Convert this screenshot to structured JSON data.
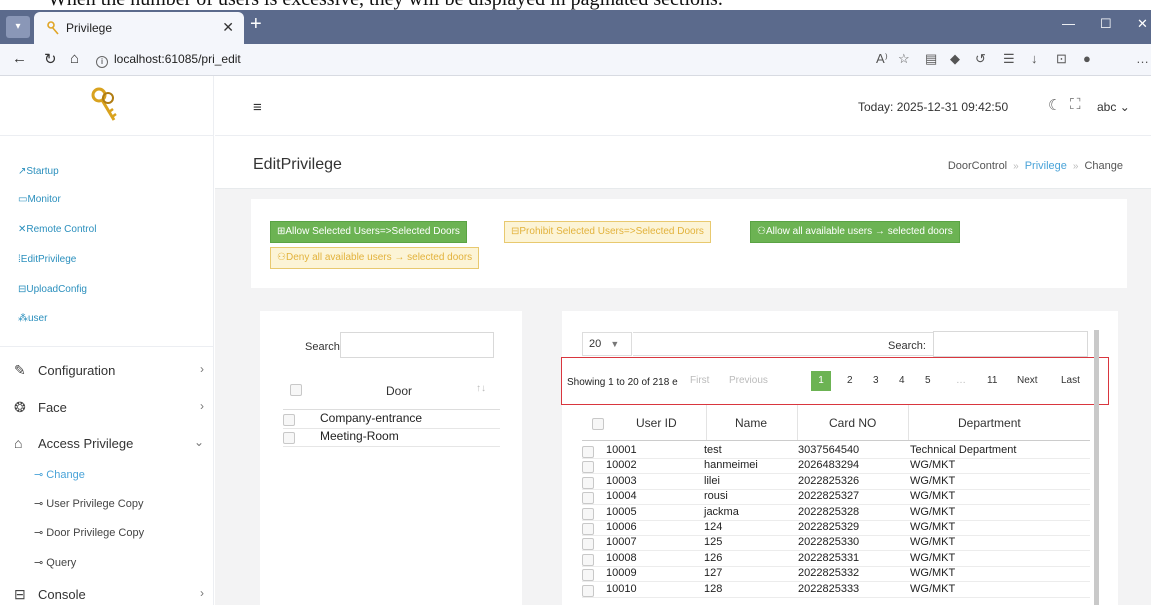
{
  "caption": "When the number of users is excessive, they will be displayed in paginated sections.",
  "browser": {
    "tab_title": "Privilege",
    "url": "localhost:61085/pri_edit"
  },
  "sidebar": {
    "links": [
      "Startup",
      "Monitor",
      "Remote Control",
      "EditPrivilege",
      "UploadConfig",
      "user"
    ],
    "menus": [
      {
        "label": "Configuration",
        "icon": "pencil-icon"
      },
      {
        "label": "Face",
        "icon": "face-icon"
      },
      {
        "label": "Access Privilege",
        "icon": "home-icon"
      },
      {
        "label": "Console",
        "icon": "console-icon"
      }
    ],
    "sub_items": [
      "Change",
      "User Privilege Copy",
      "Door Privilege Copy",
      "Query"
    ]
  },
  "header": {
    "today": "Today: 2025-12-31 09:42:50",
    "user": "abc"
  },
  "page": {
    "title": "EditPrivilege",
    "breadcrumb": [
      "DoorControl",
      "Privilege",
      "Change"
    ]
  },
  "buttons": {
    "allow_selected": "Allow Selected Users=>Selected Doors",
    "prohibit_selected": "Prohibit Selected Users=>Selected Doors",
    "allow_all": "Allow all available users → selected doors",
    "deny_all": "Deny all available users → selected doors"
  },
  "doors": {
    "search_label": "Search:",
    "header": "Door",
    "rows": [
      "Company-entrance",
      "Meeting-Room"
    ]
  },
  "users": {
    "page_size": "20",
    "search_label": "Search:",
    "info": "Showing 1 to 20 of 218 e",
    "pagination": {
      "first": "First",
      "previous": "Previous",
      "pages": [
        "1",
        "2",
        "3",
        "4",
        "5",
        "…",
        "11"
      ],
      "next": "Next",
      "last": "Last"
    },
    "columns": [
      "User ID",
      "Name",
      "Card NO",
      "Department"
    ],
    "rows": [
      [
        "10001",
        "test",
        "3037564540",
        "Technical Department"
      ],
      [
        "10002",
        "hanmeimei",
        "2026483294",
        "WG/MKT"
      ],
      [
        "10003",
        "lilei",
        "2022825326",
        "WG/MKT"
      ],
      [
        "10004",
        "rousi",
        "2022825327",
        "WG/MKT"
      ],
      [
        "10005",
        "jackma",
        "2022825328",
        "WG/MKT"
      ],
      [
        "10006",
        "124",
        "2022825329",
        "WG/MKT"
      ],
      [
        "10007",
        "125",
        "2022825330",
        "WG/MKT"
      ],
      [
        "10008",
        "126",
        "2022825331",
        "WG/MKT"
      ],
      [
        "10009",
        "127",
        "2022825332",
        "WG/MKT"
      ],
      [
        "10010",
        "128",
        "2022825333",
        "WG/MKT"
      ]
    ]
  },
  "colors": {
    "accent_green": "#6cb353",
    "warning_yellow": "#e2b23c",
    "link_blue": "#4aa3d8",
    "highlight_red": "#d9363e"
  }
}
